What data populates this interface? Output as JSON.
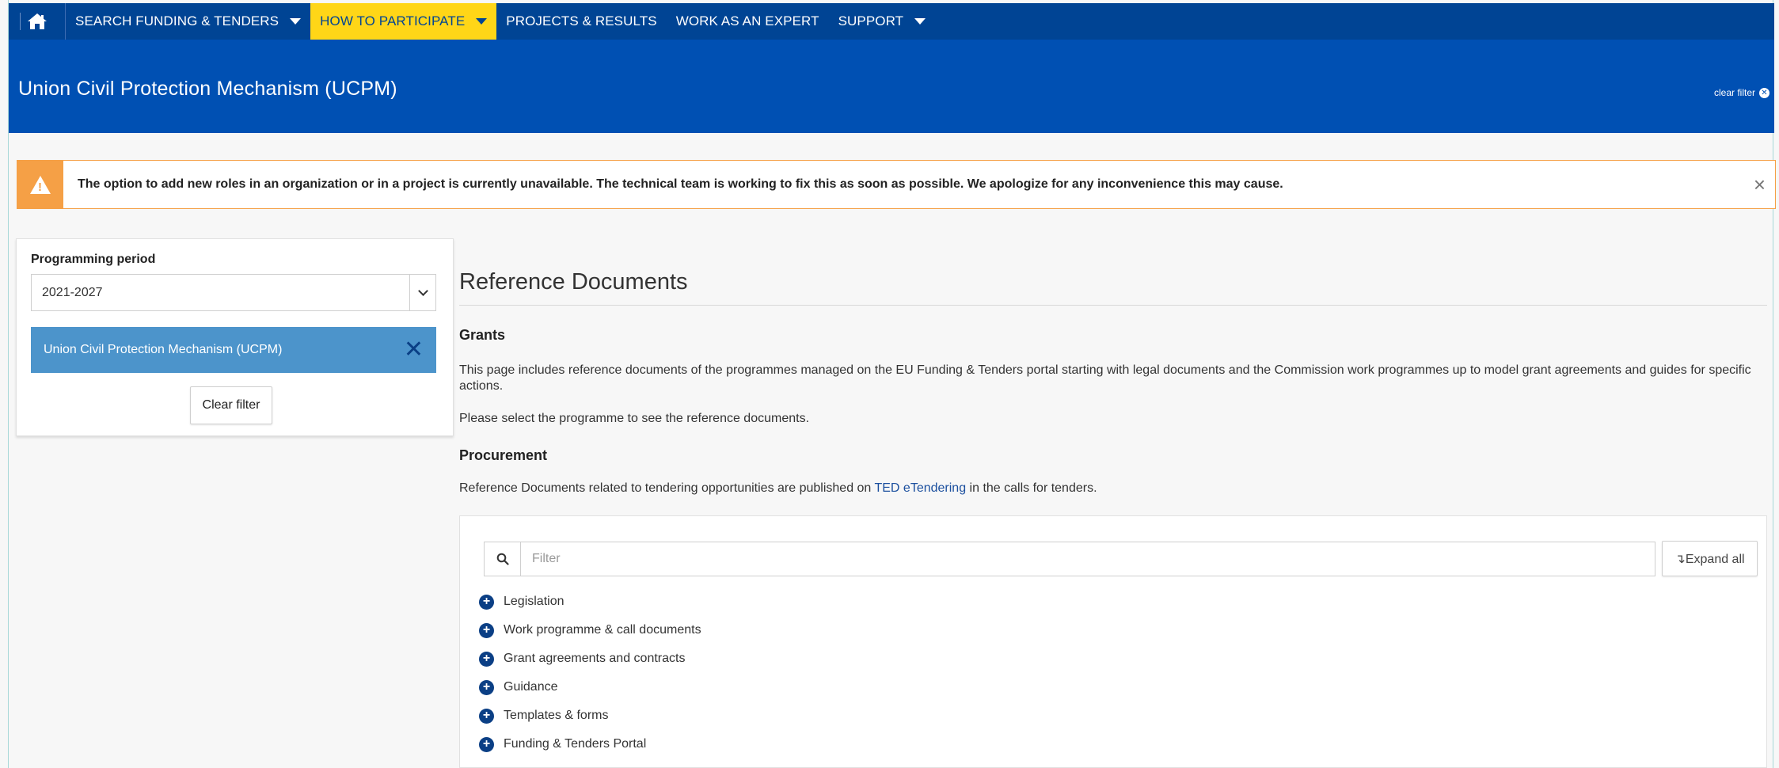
{
  "nav": {
    "items": [
      {
        "label": "SEARCH FUNDING & TENDERS",
        "dropdown": true,
        "active": false
      },
      {
        "label": "HOW TO PARTICIPATE",
        "dropdown": true,
        "active": true
      },
      {
        "label": "PROJECTS & RESULTS",
        "dropdown": false,
        "active": false
      },
      {
        "label": "WORK AS AN EXPERT",
        "dropdown": false,
        "active": false
      },
      {
        "label": "SUPPORT",
        "dropdown": true,
        "active": false
      }
    ]
  },
  "header": {
    "title": "Union Civil Protection Mechanism (UCPM)",
    "clear_filter": "clear filter"
  },
  "alert": {
    "message": "The option to add new roles in an organization or in a project is currently unavailable. The technical team is working to fix this as soon as possible. We apologize for any inconvenience this may cause.",
    "close": "×"
  },
  "sidebar": {
    "period_label": "Programming period",
    "period_value": "2021-2027",
    "selected_programme": "Union Civil Protection Mechanism (UCPM)",
    "clear_button": "Clear filter"
  },
  "main": {
    "title": "Reference Documents",
    "grants_heading": "Grants",
    "grants_text": "This page includes reference documents of the programmes managed on the EU Funding & Tenders portal starting with legal documents and the Commission work programmes up to model grant agreements and guides for specific actions.",
    "select_text": "Please select the programme to see the reference documents.",
    "procurement_heading": "Procurement",
    "procurement_text_before": "Reference Documents related to tendering opportunities are published on ",
    "procurement_link": "TED eTendering",
    "procurement_text_after": " in the calls for tenders."
  },
  "docs": {
    "filter_placeholder": "Filter",
    "expand_all": "↴Expand all",
    "categories": [
      "Legislation",
      "Work programme & call documents",
      "Grant agreements and contracts",
      "Guidance",
      "Templates & forms",
      "Funding & Tenders Portal"
    ]
  },
  "colors": {
    "nav_bg": "#004494",
    "header_bg": "#0050b3",
    "active_nav": "#ffd617",
    "alert_accent": "#f5a046",
    "tag_bg": "#4c94cb",
    "plus_icon": "#0b3f85"
  }
}
